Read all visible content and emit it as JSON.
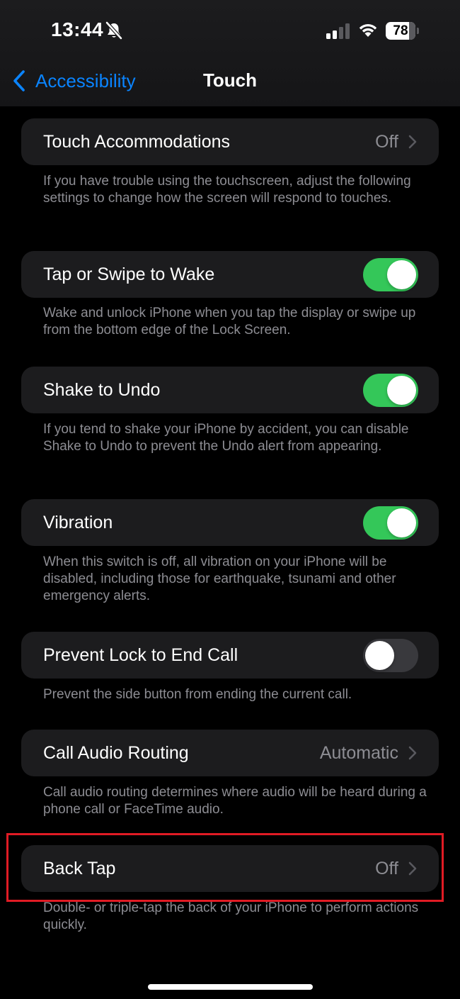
{
  "status_bar": {
    "time": "13:44",
    "battery_percent": 78,
    "battery_label": "78",
    "icons": [
      "bell-off-icon",
      "signal-icon",
      "wifi-icon",
      "battery-icon"
    ]
  },
  "nav": {
    "back_label": "Accessibility",
    "title": "Touch"
  },
  "colors": {
    "accent": "#0a84ff",
    "toggle_on": "#34c759",
    "toggle_off": "#39393d",
    "highlight": "#e01b24"
  },
  "rows": {
    "touch_accommodations": {
      "label": "Touch Accommodations",
      "value": "Off",
      "footer": "If you have trouble using the touchscreen, adjust the following settings to change how the screen will respond to touches."
    },
    "tap_to_wake": {
      "label": "Tap or Swipe to Wake",
      "state": "on",
      "footer": "Wake and unlock iPhone when you tap the display or swipe up from the bottom edge of the Lock Screen."
    },
    "shake_to_undo": {
      "label": "Shake to Undo",
      "state": "on",
      "footer": "If you tend to shake your iPhone by accident, you can disable Shake to Undo to prevent the Undo alert from appearing."
    },
    "vibration": {
      "label": "Vibration",
      "state": "on",
      "footer": "When this switch is off, all vibration on your iPhone will be disabled, including those for earthquake, tsunami and other emergency alerts."
    },
    "prevent_lock": {
      "label": "Prevent Lock to End Call",
      "state": "off",
      "footer": "Prevent the side button from ending the current call."
    },
    "call_audio_routing": {
      "label": "Call Audio Routing",
      "value": "Automatic",
      "footer": "Call audio routing determines where audio will be heard during a phone call or FaceTime audio."
    },
    "back_tap": {
      "label": "Back Tap",
      "value": "Off",
      "footer": "Double- or triple-tap the back of your iPhone to perform actions quickly."
    }
  }
}
